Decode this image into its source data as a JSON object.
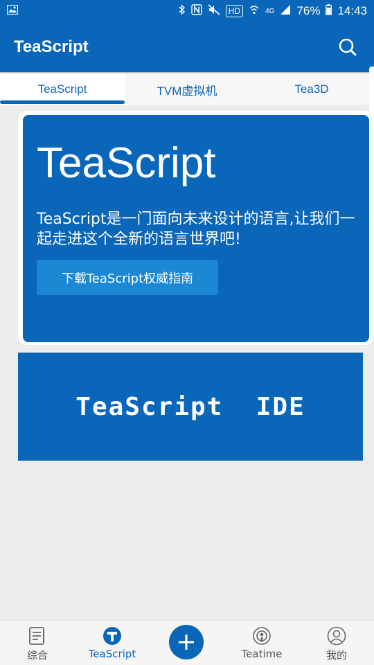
{
  "status_bar": {
    "hd": "HD",
    "network": "4G",
    "battery": "76%",
    "time": "14:43"
  },
  "app_bar": {
    "title": "TeaScript",
    "search_icon": "search-icon"
  },
  "tabs": [
    {
      "label": "TeaScript",
      "active": true
    },
    {
      "label": "TVM虚拟机",
      "active": false
    },
    {
      "label": "Tea3D",
      "active": false
    }
  ],
  "hero": {
    "title": "TeaScript",
    "description": "TeaScript是一门面向未来设计的语言,让我们一起走进这个全新的语言世界吧!",
    "button_label": "下载TeaScript权威指南"
  },
  "ide_banner": {
    "text": "TeaScript  IDE"
  },
  "bottom_nav": [
    {
      "label": "综合",
      "icon": "document-icon",
      "active": false
    },
    {
      "label": "TeaScript",
      "icon": "teascript-logo-icon",
      "active": true
    },
    {
      "label": "",
      "icon": "plus-icon",
      "active": false
    },
    {
      "label": "Teatime",
      "icon": "podcast-icon",
      "active": false
    },
    {
      "label": "我的",
      "icon": "user-icon",
      "active": false
    }
  ],
  "colors": {
    "primary": "#0a66b8",
    "button": "#1a88d3",
    "background": "#ececec"
  }
}
